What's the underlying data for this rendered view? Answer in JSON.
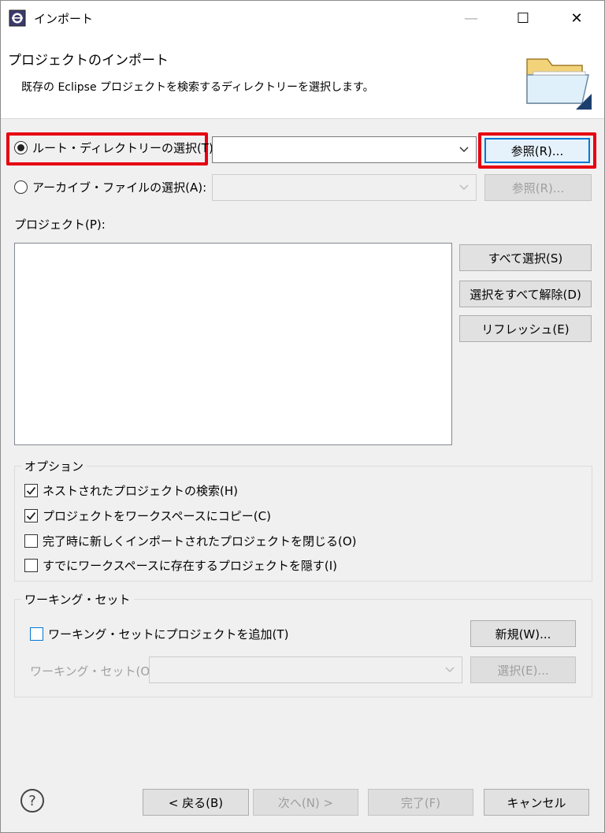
{
  "window": {
    "title": "インポート",
    "controls": {
      "minimize": "—",
      "maximize": "☐",
      "close": "✕"
    }
  },
  "header": {
    "title": "プロジェクトのインポート",
    "description": "既存の Eclipse プロジェクトを検索するディレクトリーを選択します。"
  },
  "source": {
    "root_directory": {
      "label": "ルート・ディレクトリーの選択(T):",
      "selected": true,
      "value": "",
      "browse_label": "参照(R)..."
    },
    "archive_file": {
      "label": "アーカイブ・ファイルの選択(A):",
      "selected": false,
      "value": "",
      "browse_label": "参照(R)..."
    }
  },
  "projects": {
    "label": "プロジェクト(P):",
    "items": [],
    "buttons": {
      "select_all": "すべて選択(S)",
      "deselect_all": "選択をすべて解除(D)",
      "refresh": "リフレッシュ(E)"
    }
  },
  "options": {
    "label": "オプション",
    "items": [
      {
        "label": "ネストされたプロジェクトの検索(H)",
        "checked": true
      },
      {
        "label": "プロジェクトをワークスペースにコピー(C)",
        "checked": true
      },
      {
        "label": "完了時に新しくインポートされたプロジェクトを閉じる(O)",
        "checked": false
      },
      {
        "label": "すでにワークスペースに存在するプロジェクトを隠す(I)",
        "checked": false
      }
    ]
  },
  "working_sets": {
    "label": "ワーキング・セット",
    "add_checkbox": {
      "label": "ワーキング・セットにプロジェクトを追加(T)",
      "checked": false
    },
    "new_button": "新規(W)...",
    "combo_label": "ワーキング・セット(O):",
    "combo_value": "",
    "select_button": "選択(E)..."
  },
  "footer": {
    "help": "?",
    "back": "< 戻る(B)",
    "next": "次へ(N) >",
    "finish": "完了(F)",
    "cancel": "キャンセル"
  },
  "colors": {
    "highlight": "#e60012",
    "focus_blue": "#0078d7",
    "dialog_bg": "#f0f0f0"
  }
}
